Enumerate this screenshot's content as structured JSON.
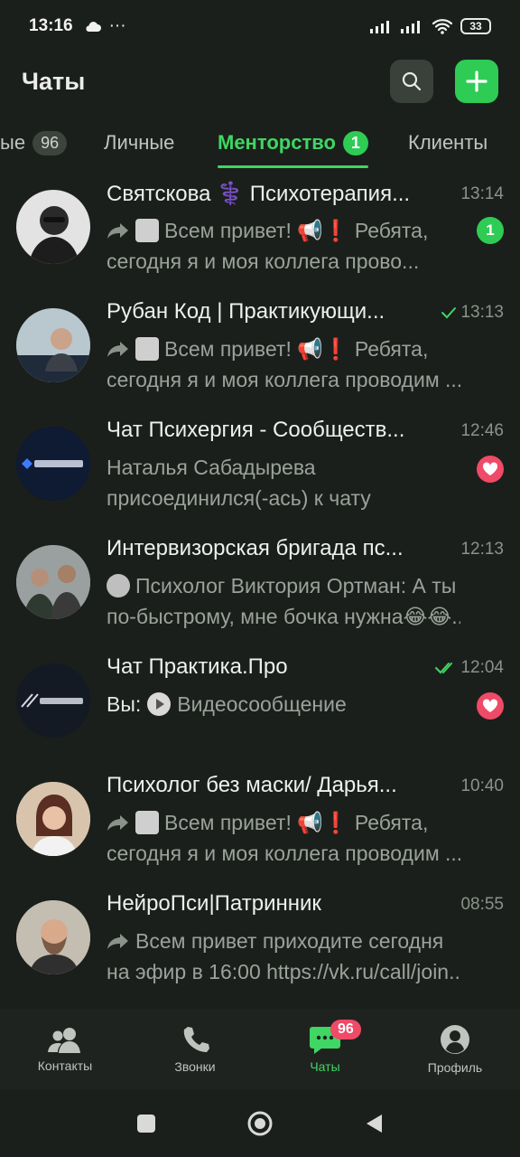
{
  "status_bar": {
    "time": "13:16",
    "extra": "···",
    "battery": "33"
  },
  "header": {
    "title": "Чаты"
  },
  "tabs": [
    {
      "label": "ые",
      "badge": "96"
    },
    {
      "label": "Личные"
    },
    {
      "label": "Менторство",
      "badge": "1"
    },
    {
      "label": "Клиенты"
    }
  ],
  "chats": [
    {
      "title": "Святскова ⚕️ Психотерапия...",
      "time": "13:14",
      "line1": "Всем привет! 📢❗ Ребята,",
      "line2": "сегодня я и моя коллега прово...",
      "unread": "1"
    },
    {
      "title": "Рубан Код | Практикующи...",
      "time": "13:13",
      "line1": "Всем привет! 📢❗ Ребята,",
      "line2": "сегодня я и моя коллега проводим ..."
    },
    {
      "title": "Чат Психергия - Сообществ...",
      "time": "12:46",
      "line1": "Наталья Сабадырева",
      "line2": "присоединился(-ась) к чату"
    },
    {
      "title": "Интервизорская бригада пс...",
      "time": "12:13",
      "line1": "Психолог Виктория Ортман: А ты",
      "line2": "по-быстрому, мне бочка нужна😂😂..."
    },
    {
      "title": "Чат Практика.Про",
      "time": "12:04",
      "line1_prefix": "Вы:",
      "line1": "Видеосообщение"
    },
    {
      "title": "Психолог без маски/ Дарья...",
      "time": "10:40",
      "line1": "Всем привет! 📢❗ Ребята,",
      "line2": "сегодня я и моя коллега проводим ..."
    },
    {
      "title": "НейроПси|Патринник",
      "time": "08:55",
      "line1": "Всем привет приходите сегодня",
      "line2": "на эфир в 16:00 https://vk.ru/call/join..."
    }
  ],
  "bottom_nav": [
    {
      "label": "Контакты"
    },
    {
      "label": "Звонки"
    },
    {
      "label": "Чаты",
      "badge": "96"
    },
    {
      "label": "Профиль"
    }
  ],
  "colors": {
    "background": "#1b1f1b",
    "accent": "#3fd663",
    "badge_red": "#ef4a67"
  }
}
